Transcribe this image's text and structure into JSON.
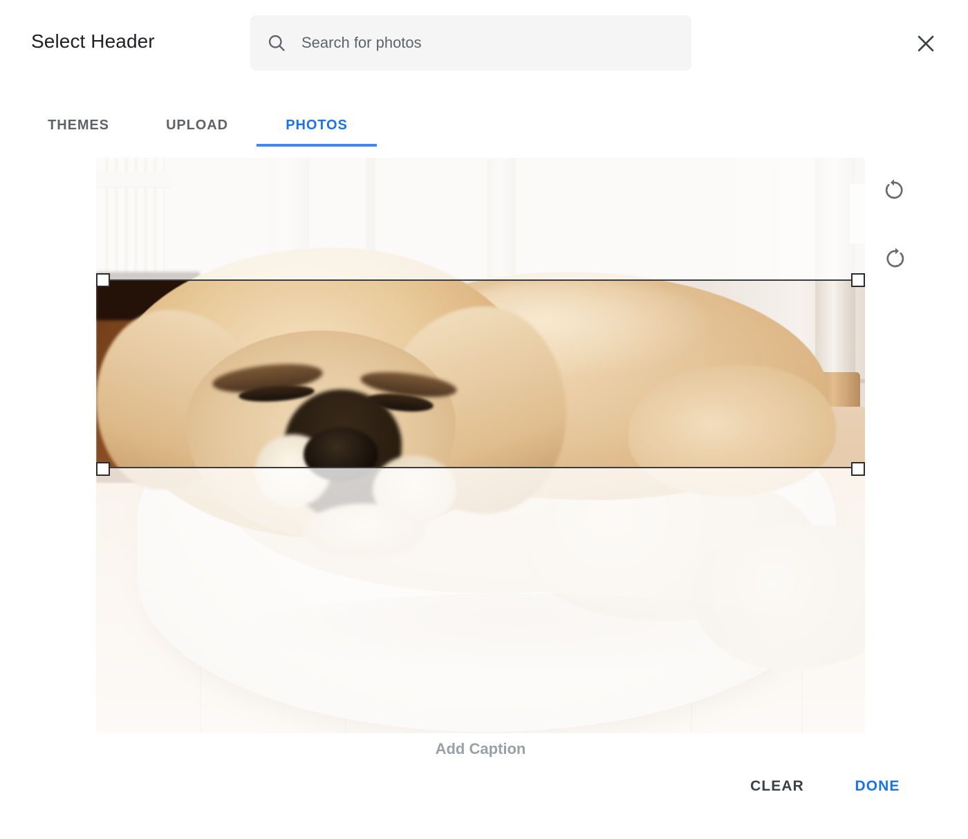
{
  "dialog": {
    "title": "Select Header",
    "close_icon": "close-icon"
  },
  "search": {
    "placeholder": "Search for photos",
    "value": "",
    "icon": "search-icon"
  },
  "tabs": [
    {
      "label": "THEMES",
      "active": false
    },
    {
      "label": "UPLOAD",
      "active": false
    },
    {
      "label": "PHOTOS",
      "active": true
    }
  ],
  "editor": {
    "image_description": "Sleeping tan Pekingese dog curled up in a white round dog bed on a light wood floor",
    "crop_handles": [
      "top-left",
      "top-right",
      "bottom-left",
      "bottom-right"
    ],
    "rotate_left_icon": "rotate-left-icon",
    "rotate_right_icon": "rotate-right-icon",
    "caption_placeholder": "Add Caption"
  },
  "footer": {
    "clear_label": "CLEAR",
    "done_label": "DONE"
  },
  "colors": {
    "accent": "#1a73e8",
    "tab_underline": "#4285f4",
    "title_text": "#202124",
    "muted_text": "#5f6368",
    "caption_text": "#9aa0a6",
    "search_bg": "#f5f5f5",
    "crop_border": "#3c3c3c"
  }
}
